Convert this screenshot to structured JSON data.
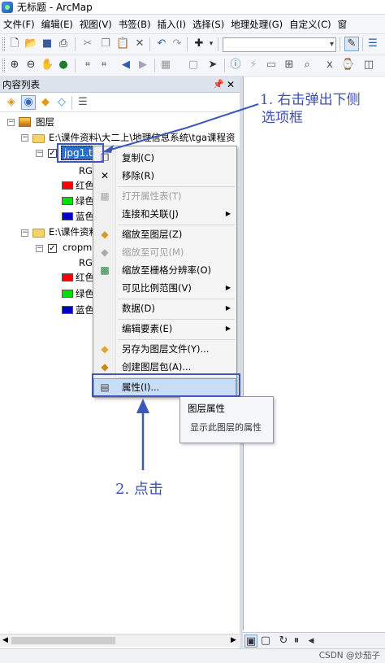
{
  "window": {
    "title": "无标题 - ArcMap"
  },
  "menus": [
    "文件(F)",
    "编辑(E)",
    "视图(V)",
    "书签(B)",
    "插入(I)",
    "选择(S)",
    "地理处理(G)",
    "自定义(C)",
    "窗"
  ],
  "toc": {
    "title": "内容列表",
    "root": "图层",
    "group1": "E:\\课件资料\\大二上\\地理信息系统\\tga课程资",
    "layer1": "jpg1.ti",
    "layer1_rgb": "RG",
    "band_red": "红色",
    "band_green": "绿色",
    "band_blue": "蓝色",
    "group2": "E:\\课件资料",
    "layer2": "cropm",
    "layer2_rgb": "RG"
  },
  "context_menu": {
    "copy": "复制(C)",
    "remove": "移除(R)",
    "open_table": "打开属性表(T)",
    "joins": "连接和关联(J)",
    "zoom_layer": "缩放至图层(Z)",
    "zoom_visible": "缩放至可见(M)",
    "zoom_raster": "缩放至栅格分辨率(O)",
    "visible_scale": "可见比例范围(V)",
    "data": "数据(D)",
    "edit_features": "编辑要素(E)",
    "save_as_lyr": "另存为图层文件(Y)...",
    "create_pkg": "创建图层包(A)...",
    "properties": "属性(I)..."
  },
  "tooltip": {
    "title": "图层属性",
    "description": "显示此图层的属性"
  },
  "annotations": {
    "step1_line1": "1. 右击弹出下侧",
    "step1_line2": "选项框",
    "step2": "2. 点击"
  },
  "watermark": "CSDN @炒茄子",
  "colors": {
    "annotation": "#3d58b8",
    "selection": "#2b6fce",
    "red": "#ff0000",
    "green": "#00e000",
    "blue": "#0000cc"
  }
}
